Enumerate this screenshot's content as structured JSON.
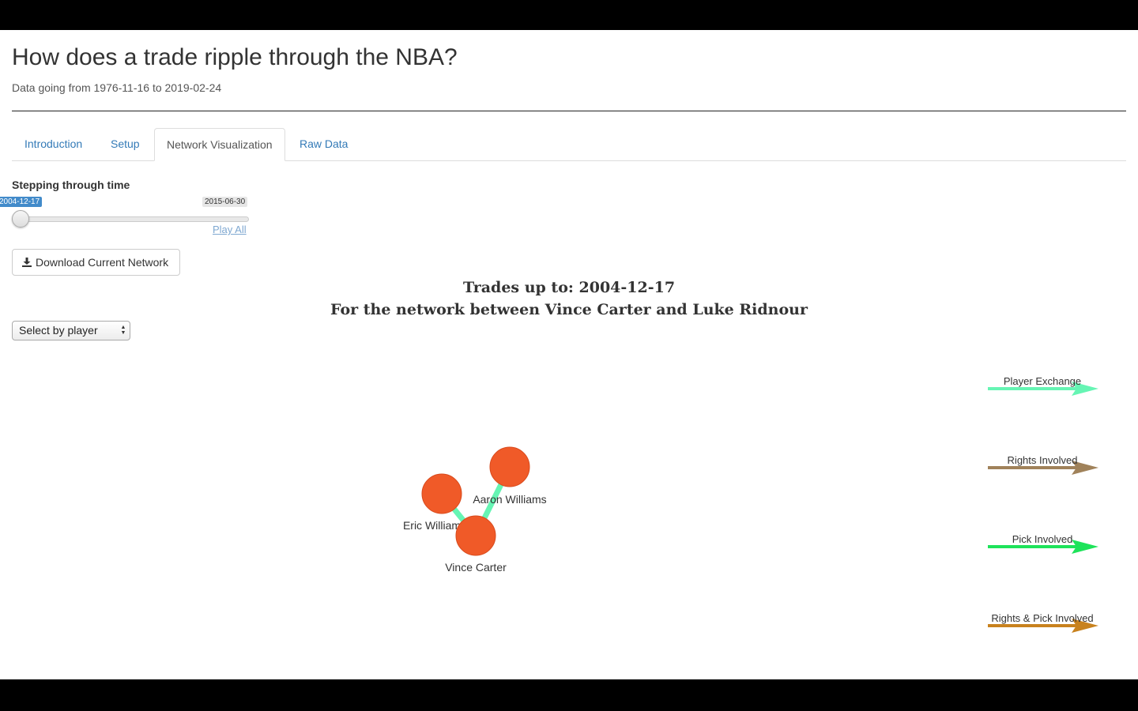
{
  "header": {
    "title": "How does a trade ripple through the NBA?",
    "subtitle": "Data going from 1976-11-16 to 2019-02-24"
  },
  "tabs": [
    {
      "label": "Introduction",
      "active": false
    },
    {
      "label": "Setup",
      "active": false
    },
    {
      "label": "Network Visualization",
      "active": true
    },
    {
      "label": "Raw Data",
      "active": false
    }
  ],
  "controls": {
    "slider_label": "Stepping through time",
    "slider_current": "2004-12-17",
    "slider_max": "2015-06-30",
    "slider_progress": 0,
    "play_all": "Play All",
    "download_button": "Download Current Network",
    "player_select": "Select by player"
  },
  "network": {
    "title_line1": "Trades up to: 2004-12-17",
    "title_line2": "For the network between Vince Carter and Luke Ridnour",
    "nodes": [
      {
        "id": "eric",
        "label": "Eric Williams",
        "color": "#f05a28"
      },
      {
        "id": "aaron",
        "label": "Aaron Williams",
        "color": "#f05a28"
      },
      {
        "id": "vince",
        "label": "Vince Carter",
        "color": "#f05a28"
      }
    ],
    "edges": [
      {
        "from": "eric",
        "to": "vince",
        "type": "Player Exchange"
      },
      {
        "from": "aaron",
        "to": "vince",
        "type": "Player Exchange"
      }
    ]
  },
  "legend": [
    {
      "label": "Player Exchange",
      "color": "#66f5b4"
    },
    {
      "label": "Rights Involved",
      "color": "#a0825a"
    },
    {
      "label": "Pick Involved",
      "color": "#1ee35a"
    },
    {
      "label": "Rights & Pick Involved",
      "color": "#c8821e"
    }
  ]
}
